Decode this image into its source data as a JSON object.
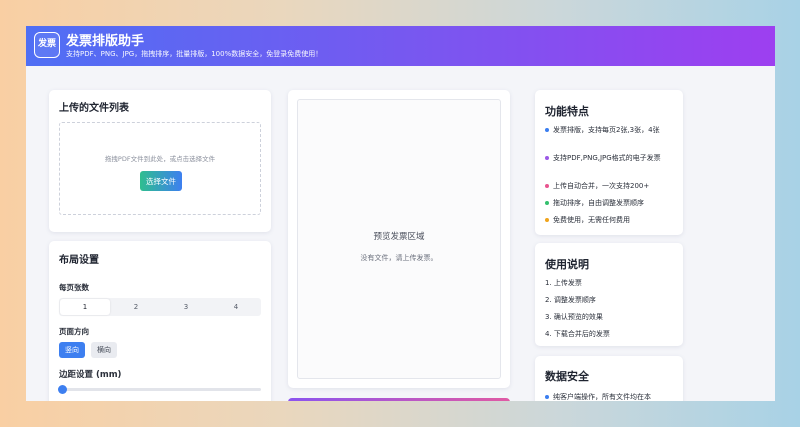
{
  "header": {
    "logo_text": "发票",
    "title": "发票排版助手",
    "subtitle": "支持PDF、PNG、JPG，拖拽排序，批量排版，100%数据安全，免登录免费使用！"
  },
  "upload": {
    "title": "上传的文件列表",
    "hint": "拖拽PDF文件到此处，或点击选择文件",
    "button": "选择文件"
  },
  "layout": {
    "title": "布局设置",
    "per_page_label": "每页张数",
    "per_page_options": [
      "1",
      "2",
      "3",
      "4"
    ],
    "per_page_selected": "1",
    "orientation_label": "页面方向",
    "orientation_options": [
      "竖向",
      "横向"
    ],
    "orientation_selected": "竖向",
    "margin_label": "边距设置 (mm)",
    "margin_value_fraction": 0
  },
  "preview": {
    "title": "预览发票区域",
    "empty": "没有文件，请上传发票。"
  },
  "features": {
    "title": "功能特点",
    "items": [
      {
        "text": "发票排版，支持每页2张,3张，4张",
        "color": "#3b7ef0"
      },
      {
        "text": "支持PDF,PNG,JPG格式的电子发票",
        "color": "#9b59e6"
      },
      {
        "text": "上传自动合并，一次支持200+",
        "color": "#e8558f"
      },
      {
        "text": "拖动排序，自由调整发票顺序",
        "color": "#34c06e"
      },
      {
        "text": "免费使用，无需任何费用",
        "color": "#f0a41c"
      }
    ]
  },
  "usage": {
    "title": "使用说明",
    "steps": [
      "1. 上传发票",
      "2. 调整发票顺序",
      "3. 确认预览的效果",
      "4. 下载合并后的发票"
    ]
  },
  "security": {
    "title": "数据安全",
    "text": "纯客户端操作，所有文件均在本",
    "color": "#3b7ef0"
  },
  "colors": {
    "accent": "#3d7ff0",
    "header_gradient_start": "#4f6ff4",
    "header_gradient_end": "#9d3ff0"
  }
}
